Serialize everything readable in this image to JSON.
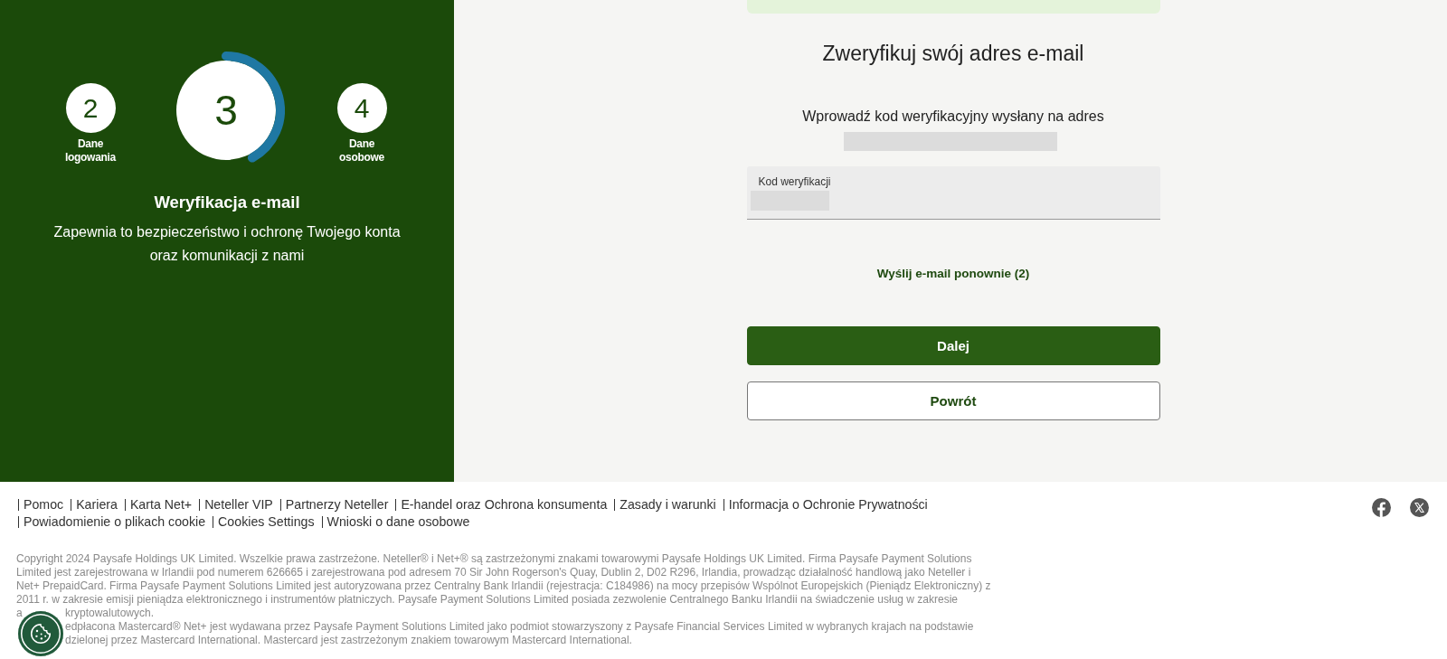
{
  "left_panel": {
    "steps": [
      {
        "number": "2",
        "label": "Dane logowania",
        "selected": false
      },
      {
        "number": "3",
        "selected": true,
        "level": 0.42
      },
      {
        "number": "4",
        "label": "Dane osobowe",
        "selected": false
      }
    ],
    "title": "Weryfikacja e-mail",
    "description": "Zapewnia to bezpieczeństwo i ochronę Twojego konta oraz komunikacji z nami"
  },
  "form": {
    "top_alert": {
      "kind": "success"
    },
    "title": "Zweryfikuj swój adres e-mail",
    "instruction": "Wprowadź kod weryfikacyjny wysłany na adres",
    "email_redacted": true,
    "code_field": {
      "label": "Kod weryfikacji",
      "value_redacted": true
    },
    "resend_link": "Wyślij e-mail ponownie (2)",
    "buttons": [
      {
        "label": "Dalej",
        "kind": "primary"
      },
      {
        "label": "Powrót",
        "kind": "secondary"
      }
    ]
  },
  "footer": {
    "link_rows": [
      [
        "Pomoc",
        "Kariera",
        "Karta Net+",
        "Neteller VIP",
        "Partnerzy Neteller",
        "E-handel oraz Ochrona konsumenta",
        "Zasady i warunki",
        "Informacja o Ochronie Prywatności"
      ],
      [
        "Powiadomienie o plikach cookie",
        "Cookies Settings",
        "Wnioski o dane osobowe"
      ]
    ],
    "social": [
      {
        "kind": "facebook"
      },
      {
        "kind": "x"
      }
    ],
    "copyright_lines": [
      {
        "text": "Copyright 2024 Paysafe Holdings UK Limited. Wszelkie prawa zastrzeżone. Neteller® i Net+® są zastrzeżonymi znakami towarowymi Paysafe Holdings UK Limited. Firma Paysafe Payment Solutions"
      },
      {
        "text": "Limited jest zarejestrowana w Irlandii pod numerem 626665 i zarejestrowana pod adresem 70 Sir John Rogerson's Quay, Dublin 2, D02 R296, Irlandia, prowadząc działalność handlową jako Neteller i"
      },
      {
        "text": "Net+ PrepaidCard. Firma Paysafe Payment Solutions Limited jest autoryzowana przez Centralny Bank Irlandii (rejestracja: C184986) na mocy przepisów Wspólnot Europejskich (Pieniądz Elektroniczny) z"
      },
      {
        "text": "2011 r. w zakresie emisji pieniądza elektronicznego i instrumentów płatniczych. Paysafe Payment Solutions Limited posiada zezwolenie Centralnego Banku Irlandii na świadczenie usług w zakresie"
      },
      {
        "before_button": "a",
        "after_button": "kryptowalutowych."
      },
      {
        "after_button": "edpłacona Mastercard® Net+ jest wydawana przez Paysafe Payment Solutions Limited jako podmiot stowarzyszony z Paysafe Financial Services Limited w wybranych krajach na podstawie"
      },
      {
        "after_button": "dzielonej przez Mastercard International. Mastercard jest zastrzeżonym znakiem towarowym Mastercard International."
      }
    ]
  }
}
